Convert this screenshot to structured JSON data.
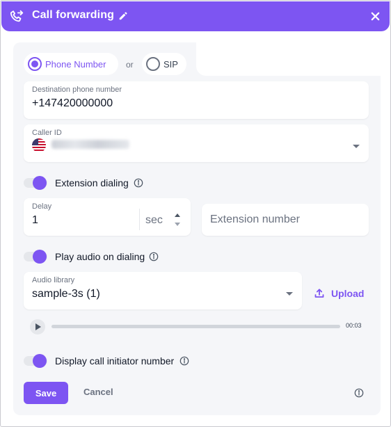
{
  "header": {
    "title": "Call forwarding",
    "accent_color": "#7d55f2",
    "icons": [
      "call-forward-icon",
      "edit-icon",
      "close-icon"
    ]
  },
  "destination_type": {
    "options": [
      "Phone Number",
      "SIP"
    ],
    "selected": "Phone Number",
    "separator": "or"
  },
  "destination_phone": {
    "label": "Destination phone number",
    "value": "+147420000000"
  },
  "caller_id": {
    "label": "Caller ID",
    "flag_icon": "us-flag-icon"
  },
  "extension_dialing": {
    "label": "Extension dialing",
    "enabled": true
  },
  "delay": {
    "label": "Delay",
    "value": "1",
    "unit": "sec"
  },
  "extension_number": {
    "placeholder": "Extension number"
  },
  "play_audio": {
    "label": "Play audio on dialing",
    "enabled": true
  },
  "audio_library": {
    "label": "Audio library",
    "value": "sample-3s (1)",
    "upload_label": "Upload"
  },
  "player": {
    "duration": "00:03",
    "progress": 0
  },
  "display_initiator": {
    "label": "Display call initiator number",
    "enabled": true
  },
  "actions": {
    "save_label": "Save",
    "cancel_label": "Cancel"
  }
}
